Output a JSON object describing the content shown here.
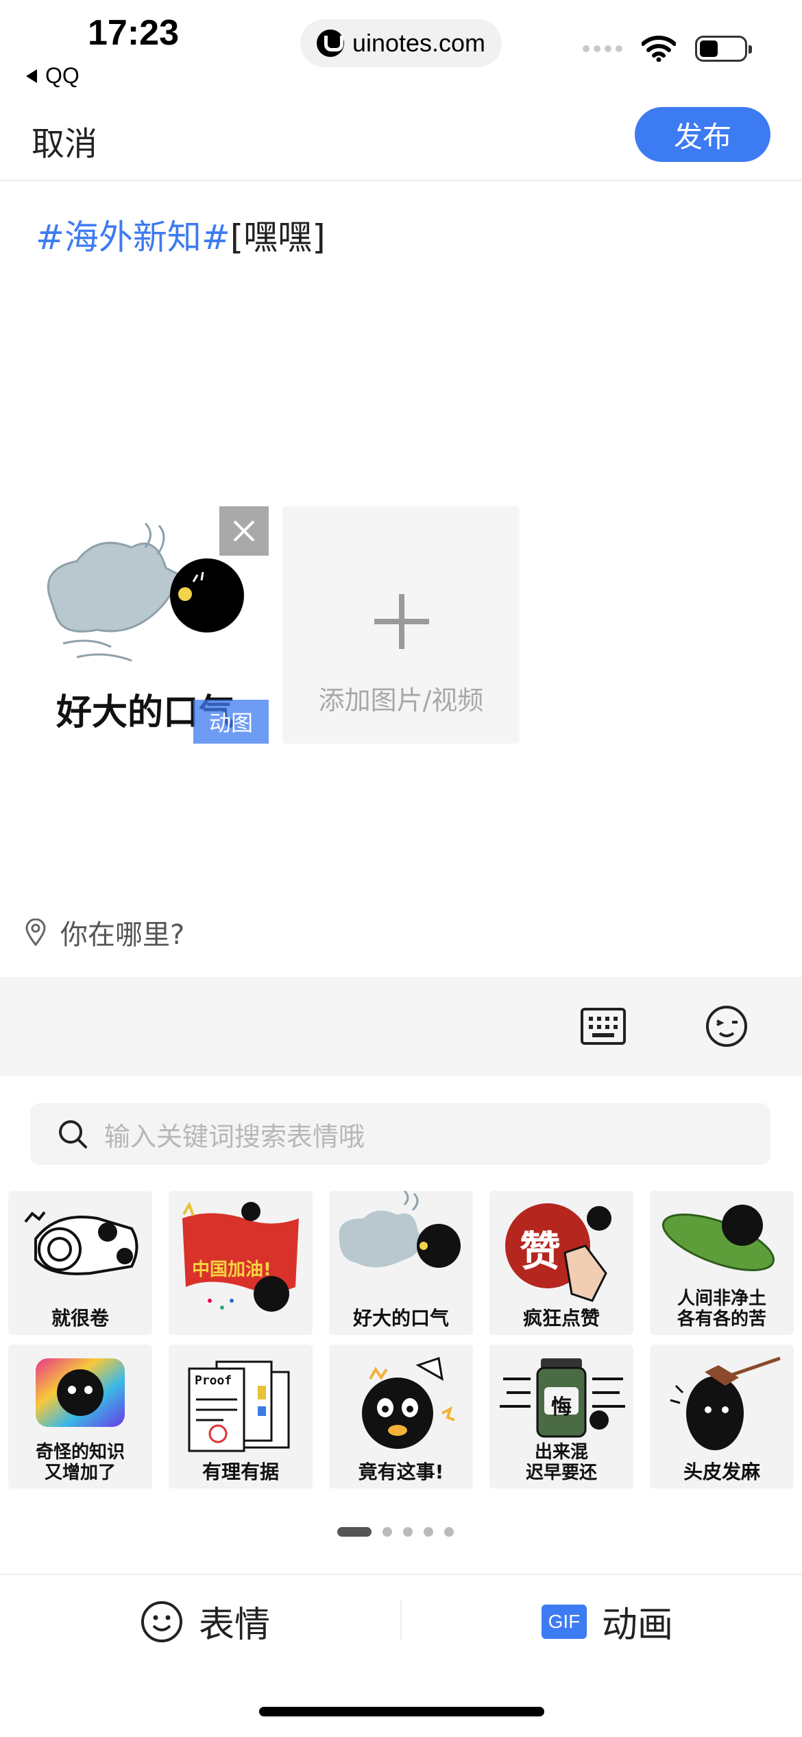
{
  "status_bar": {
    "time": "17:23",
    "back_app": "QQ",
    "url": "uinotes.com"
  },
  "nav": {
    "cancel_label": "取消",
    "publish_label": "发布"
  },
  "post": {
    "topic": "#海外新知#",
    "emoji_code": "[嘿嘿]"
  },
  "media": {
    "thumb_caption": "好大的口气",
    "gif_tag": "动图",
    "add_label": "添加图片/视频"
  },
  "location": {
    "placeholder": "你在哪里?"
  },
  "search": {
    "placeholder": "输入关键词搜索表情哦"
  },
  "stickers": [
    {
      "caption": "就很卷"
    },
    {
      "caption": "",
      "banner": "中国加油!"
    },
    {
      "caption": "好大的口气"
    },
    {
      "caption": "疯狂点赞",
      "badge": "赞"
    },
    {
      "caption": "人间非净土\n各有各的苦"
    },
    {
      "caption": "奇怪的知识\n又增加了"
    },
    {
      "caption": "有理有据",
      "badge": "Proof"
    },
    {
      "caption": "竟有这事!"
    },
    {
      "caption": "出来混\n迟早要还",
      "badge": "悔"
    },
    {
      "caption": "头皮发麻"
    }
  ],
  "pagination": {
    "pages": 5,
    "current": 1
  },
  "tabs": {
    "emoji_label": "表情",
    "anim_label": "动画",
    "gif_badge": "GIF"
  },
  "colors": {
    "accent": "#3d7bf2",
    "toolbar_bg": "#f5f5f5"
  }
}
